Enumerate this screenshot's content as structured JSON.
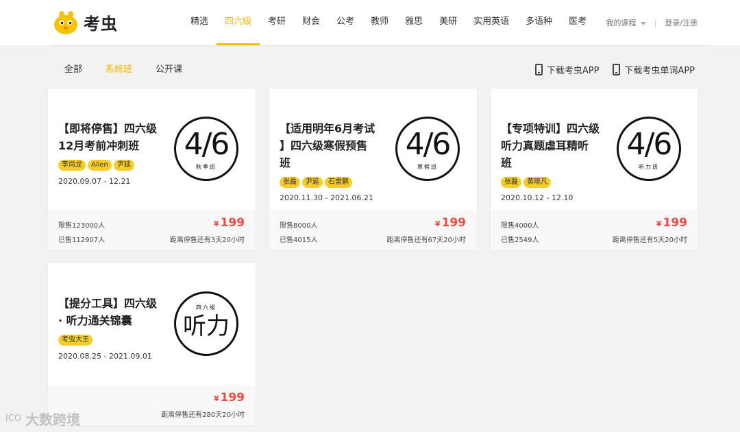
{
  "brand": {
    "name": "考虫",
    "color": "#f5c400"
  },
  "nav": {
    "items": [
      "精选",
      "四六级",
      "考研",
      "财会",
      "公考",
      "教师",
      "雅思",
      "美研",
      "实用英语",
      "多语种",
      "医考"
    ],
    "active_index": 1
  },
  "user": {
    "my_courses": "我的课程",
    "login": "登录/注册"
  },
  "subtabs": {
    "items": [
      "全部",
      "系统班",
      "公开课"
    ],
    "active_index": 1
  },
  "downloads": [
    "下载考虫APP",
    "下载考虫单词APP"
  ],
  "cards": [
    {
      "title_lines": [
        "【即将停售】四六级",
        "12月考前冲刺班"
      ],
      "tags": [
        "李尚龙",
        "Allen",
        "尹延"
      ],
      "date": "2020.09.07 - 12.21",
      "badge": {
        "main": "4/6",
        "sub": "秋季班"
      },
      "limit": "限售123000人",
      "sold": "已售112907人",
      "price_symbol": "¥",
      "price": "199",
      "countdown": "距离停售还有3天20小时"
    },
    {
      "title_lines": [
        "【适用明年6月考试",
        "】四六级寒假预售",
        "班"
      ],
      "tags": [
        "张磊",
        "尹延",
        "石雷鹏"
      ],
      "date": "2020.11.30 - 2021.06.21",
      "badge": {
        "main": "4/6",
        "sub": "寒假班"
      },
      "limit": "限售8000人",
      "sold": "已售4015人",
      "price_symbol": "¥",
      "price": "199",
      "countdown": "距离停售还有67天20小时"
    },
    {
      "title_lines": [
        "【专项特训】四六级",
        "听力真题虐耳精听",
        "班"
      ],
      "tags": [
        "张磊",
        "黄晓凡"
      ],
      "date": "2020.10.12 - 12.10",
      "badge": {
        "main": "4/6",
        "sub": "听力班"
      },
      "limit": "限售4000人",
      "sold": "已售2549人",
      "price_symbol": "¥",
      "price": "199",
      "countdown": "距离停售还有5天20小时"
    },
    {
      "title_lines": [
        "【提分工具】四六级",
        "· 听力通关锦囊"
      ],
      "tags": [
        "考虫大王"
      ],
      "date": "2020.08.25 - 2021.09.01",
      "badge": {
        "topsub": "四六级",
        "main": "听力"
      },
      "price_symbol": "¥",
      "price": "199",
      "countdown": "距离停售还有280天20小时"
    }
  ],
  "watermark": {
    "logo": "ICO",
    "text": "大数跨境"
  }
}
